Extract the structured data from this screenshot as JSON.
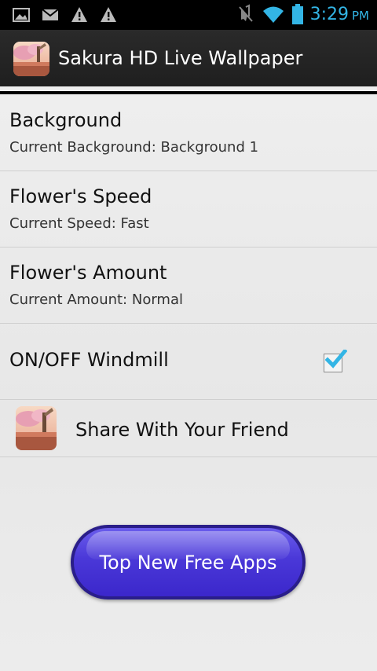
{
  "status_bar": {
    "icons": [
      "image-icon",
      "gmail-icon",
      "warning-icon",
      "warning-icon",
      "mute-icon",
      "wifi-icon",
      "battery-icon"
    ],
    "time": "3:29",
    "ampm": "PM",
    "accent_color": "#33b5e5"
  },
  "action_bar": {
    "title": "Sakura HD Live Wallpaper"
  },
  "preferences": [
    {
      "title": "Background",
      "summary": "Current Background: Background 1"
    },
    {
      "title": "Flower's Speed",
      "summary": "Current Speed: Fast"
    },
    {
      "title": "Flower's Amount",
      "summary": "Current Amount: Normal"
    },
    {
      "title": "ON/OFF Windmill",
      "checked": true
    }
  ],
  "share": {
    "label": "Share With Your Friend"
  },
  "promo_button": {
    "label": "Top New Free Apps",
    "color": "#4a38d8"
  }
}
